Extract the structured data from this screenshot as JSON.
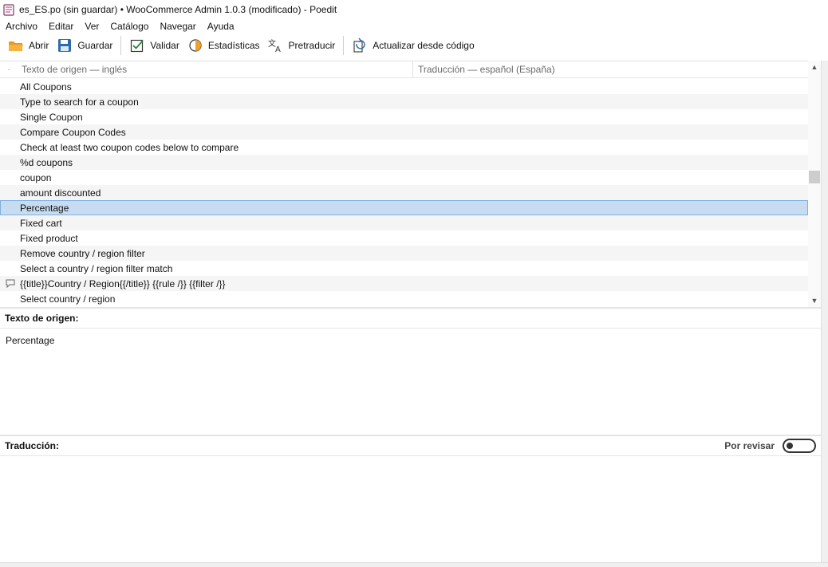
{
  "window": {
    "title": "es_ES.po (sin guardar) • WooCommerce Admin 1.0.3 (modificado) - Poedit"
  },
  "menu": [
    "Archivo",
    "Editar",
    "Ver",
    "Catálogo",
    "Navegar",
    "Ayuda"
  ],
  "toolbar": {
    "open_label": "Abrir",
    "save_label": "Guardar",
    "validate_label": "Validar",
    "stats_label": "Estadísticas",
    "pretranslate_label": "Pretraducir",
    "update_label": "Actualizar desde código"
  },
  "list": {
    "col_marker": "·",
    "col_source": "Texto de origen — inglés",
    "col_translation": "Traducción — español (España)",
    "rows": [
      {
        "source": "All Coupons",
        "comment": false
      },
      {
        "source": "Type to search for a coupon",
        "comment": false
      },
      {
        "source": "Single Coupon",
        "comment": false
      },
      {
        "source": "Compare Coupon Codes",
        "comment": false
      },
      {
        "source": "Check at least two coupon codes below to compare",
        "comment": false
      },
      {
        "source": "%d coupons",
        "comment": false
      },
      {
        "source": "coupon",
        "comment": false
      },
      {
        "source": "amount discounted",
        "comment": false
      },
      {
        "source": "Percentage",
        "comment": false,
        "selected": true
      },
      {
        "source": "Fixed cart",
        "comment": false
      },
      {
        "source": "Fixed product",
        "comment": false
      },
      {
        "source": "Remove country / region filter",
        "comment": false
      },
      {
        "source": "Select a country / region filter match",
        "comment": false
      },
      {
        "source": "{{title}}Country / Region{{/title}} {{rule /}} {{filter /}}",
        "comment": true
      },
      {
        "source": "Select country / region",
        "comment": false
      }
    ]
  },
  "source_panel": {
    "heading": "Texto de origen:",
    "text": "Percentage"
  },
  "translation_panel": {
    "heading": "Traducción:",
    "fuzzy_label": "Por revisar",
    "value": ""
  },
  "colors": {
    "selection": "#c7dcf0",
    "accent_orange": "#f0a030",
    "accent_blue": "#2b6cb0"
  }
}
